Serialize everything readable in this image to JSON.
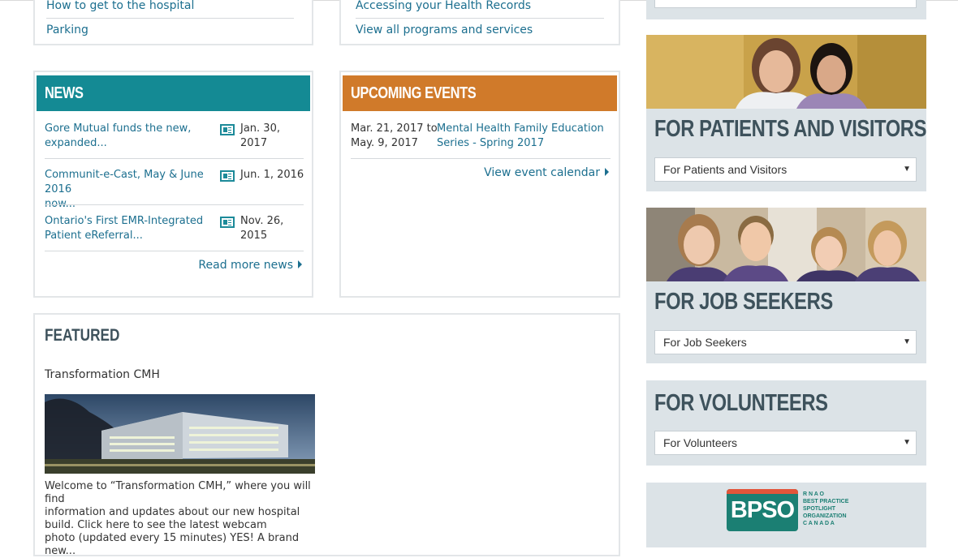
{
  "top_links": {
    "left": [
      "How to get to the hospital",
      "Parking"
    ],
    "right": [
      "Accessing your Health Records",
      "View all programs and services"
    ]
  },
  "news": {
    "title": "NEWS",
    "items": [
      {
        "text1": "Gore Mutual funds the new,",
        "text2": "expanded...",
        "date1": "Jan. 30,",
        "date2": "2017"
      },
      {
        "text1": "Communit-e-Cast, May & June 2016",
        "text2": "now...",
        "date1": "Jun. 1, 2016",
        "date2": ""
      },
      {
        "text1": "Ontario's First EMR-Integrated",
        "text2": "Patient eReferral...",
        "date1": "Nov. 26,",
        "date2": "2015"
      }
    ],
    "more": "Read more news",
    "accent": "#148a94"
  },
  "events": {
    "title": "UPCOMING EVENTS",
    "item": {
      "date1": "Mar. 21, 2017 to",
      "date2": "May. 9, 2017",
      "text1": "Mental Health Family Education",
      "text2": "Series - Spring 2017"
    },
    "more": "View event calendar",
    "accent": "#d07a2a"
  },
  "featured": {
    "title": "FEATURED",
    "subtitle": "Transformation CMH",
    "body": [
      "Welcome to “Transformation CMH,” where you will find",
      "information and updates about our new hospital",
      "build. Click here to see the latest webcam",
      "photo (updated every 15 minutes) YES! A brand new..."
    ]
  },
  "sidebar": {
    "patients": {
      "title": "FOR PATIENTS AND VISITORS",
      "select": "For Patients and Visitors"
    },
    "jobs": {
      "title": "FOR JOB SEEKERS",
      "select": "For Job Seekers"
    },
    "volunteers": {
      "title": "FOR VOLUNTEERS",
      "select": "For Volunteers"
    },
    "bpso": {
      "logo": "BPSO",
      "org": [
        "R N A O",
        "BEST PRACTICE",
        "SPOTLIGHT",
        "ORGANIZATION",
        "C A N A D A"
      ]
    }
  },
  "colors": {
    "link": "#1c6f8f",
    "sidebar_bg": "#dce3e7",
    "sidebar_title": "#3e525c"
  }
}
